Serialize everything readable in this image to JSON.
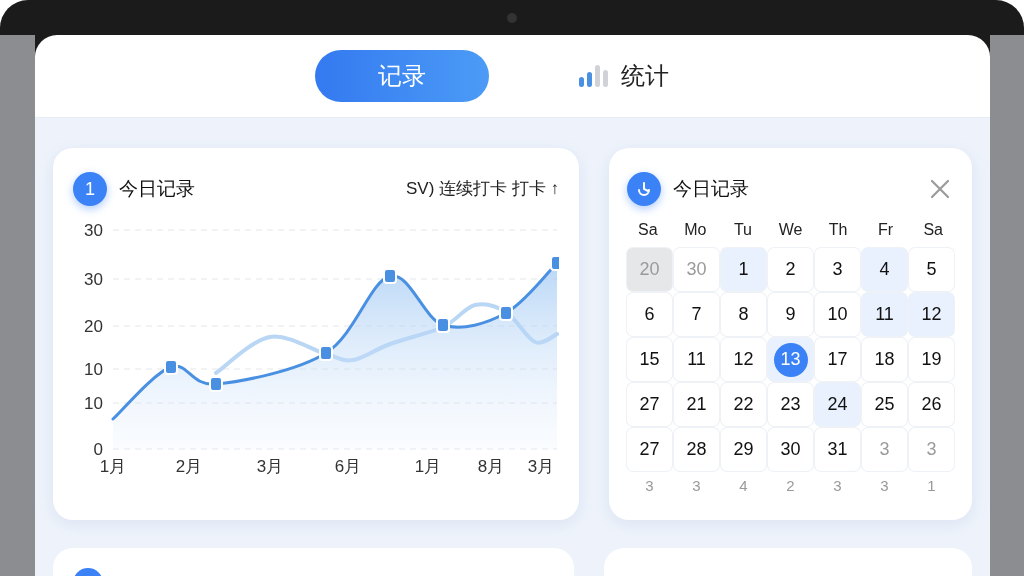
{
  "tabs": [
    {
      "label": "记录",
      "selected": true,
      "kind": "plain"
    },
    {
      "label": "统计",
      "selected": false,
      "kind": "bars"
    }
  ],
  "chart_card": {
    "badge": "1",
    "title": "今日记录",
    "streak": "SV) 连续打卡 打卡 ↑",
    "y_axis_labels": [
      "30",
      "30",
      "20",
      "10",
      "10",
      "0"
    ],
    "x_axis_labels": [
      "1月",
      "2月",
      "3月",
      "6月",
      "1月",
      "8月",
      "3月"
    ]
  },
  "calendar_card": {
    "title": "今日记录",
    "weekdays": [
      "Sa",
      "Mo",
      "Tu",
      "We",
      "Th",
      "Fr",
      "Sa"
    ],
    "rows": [
      {
        "kind": "week",
        "days": [
          {
            "label": "20",
            "muted": true,
            "shaded": true,
            "highlighted": false,
            "selected": false
          },
          {
            "label": "30",
            "muted": true,
            "shaded": false,
            "highlighted": false,
            "selected": false
          },
          {
            "label": "1",
            "muted": false,
            "shaded": false,
            "highlighted": true,
            "selected": false
          },
          {
            "label": "2",
            "muted": false,
            "shaded": false,
            "highlighted": false,
            "selected": false
          },
          {
            "label": "3",
            "muted": false,
            "shaded": false,
            "highlighted": false,
            "selected": false
          },
          {
            "label": "4",
            "muted": false,
            "shaded": false,
            "highlighted": true,
            "selected": false
          },
          {
            "label": "5",
            "muted": false,
            "shaded": false,
            "highlighted": false,
            "selected": false
          }
        ]
      },
      {
        "kind": "week",
        "days": [
          {
            "label": "6",
            "muted": false,
            "shaded": false,
            "highlighted": false,
            "selected": false
          },
          {
            "label": "7",
            "muted": false,
            "shaded": false,
            "highlighted": false,
            "selected": false
          },
          {
            "label": "8",
            "muted": false,
            "shaded": false,
            "highlighted": false,
            "selected": false
          },
          {
            "label": "9",
            "muted": false,
            "shaded": false,
            "highlighted": false,
            "selected": false
          },
          {
            "label": "10",
            "muted": false,
            "shaded": false,
            "highlighted": false,
            "selected": false
          },
          {
            "label": "11",
            "muted": false,
            "shaded": false,
            "highlighted": true,
            "selected": false
          },
          {
            "label": "12",
            "muted": false,
            "shaded": false,
            "highlighted": true,
            "selected": false
          }
        ]
      },
      {
        "kind": "week",
        "days": [
          {
            "label": "15",
            "muted": false,
            "shaded": false,
            "highlighted": false,
            "selected": false
          },
          {
            "label": "11",
            "muted": false,
            "shaded": false,
            "highlighted": false,
            "selected": false
          },
          {
            "label": "12",
            "muted": false,
            "shaded": false,
            "highlighted": false,
            "selected": false
          },
          {
            "label": "13",
            "muted": false,
            "shaded": false,
            "highlighted": true,
            "selected": true
          },
          {
            "label": "17",
            "muted": false,
            "shaded": false,
            "highlighted": false,
            "selected": false
          },
          {
            "label": "18",
            "muted": false,
            "shaded": false,
            "highlighted": false,
            "selected": false
          },
          {
            "label": "19",
            "muted": false,
            "shaded": false,
            "highlighted": false,
            "selected": false
          }
        ]
      },
      {
        "kind": "week",
        "days": [
          {
            "label": "27",
            "muted": false,
            "shaded": false,
            "highlighted": false,
            "selected": false
          },
          {
            "label": "21",
            "muted": false,
            "shaded": false,
            "highlighted": false,
            "selected": false
          },
          {
            "label": "22",
            "muted": false,
            "shaded": false,
            "highlighted": false,
            "selected": false
          },
          {
            "label": "23",
            "muted": false,
            "shaded": false,
            "highlighted": false,
            "selected": false
          },
          {
            "label": "24",
            "muted": false,
            "shaded": false,
            "highlighted": true,
            "selected": false
          },
          {
            "label": "25",
            "muted": false,
            "shaded": false,
            "highlighted": false,
            "selected": false
          },
          {
            "label": "26",
            "muted": false,
            "shaded": false,
            "highlighted": false,
            "selected": false
          }
        ]
      },
      {
        "kind": "week",
        "days": [
          {
            "label": "27",
            "muted": false,
            "shaded": false,
            "highlighted": false,
            "selected": false
          },
          {
            "label": "28",
            "muted": false,
            "shaded": false,
            "highlighted": false,
            "selected": false
          },
          {
            "label": "29",
            "muted": false,
            "shaded": false,
            "highlighted": false,
            "selected": false
          },
          {
            "label": "30",
            "muted": false,
            "shaded": false,
            "highlighted": false,
            "selected": false
          },
          {
            "label": "31",
            "muted": false,
            "shaded": false,
            "highlighted": false,
            "selected": false
          },
          {
            "label": "3",
            "muted": true,
            "shaded": false,
            "highlighted": false,
            "selected": false
          },
          {
            "label": "3",
            "muted": true,
            "shaded": false,
            "highlighted": false,
            "selected": false
          }
        ]
      },
      {
        "kind": "counts",
        "days": [
          {
            "label": "3"
          },
          {
            "label": "3"
          },
          {
            "label": "4"
          },
          {
            "label": "2"
          },
          {
            "label": "3"
          },
          {
            "label": "3"
          },
          {
            "label": "1"
          }
        ]
      }
    ]
  }
}
